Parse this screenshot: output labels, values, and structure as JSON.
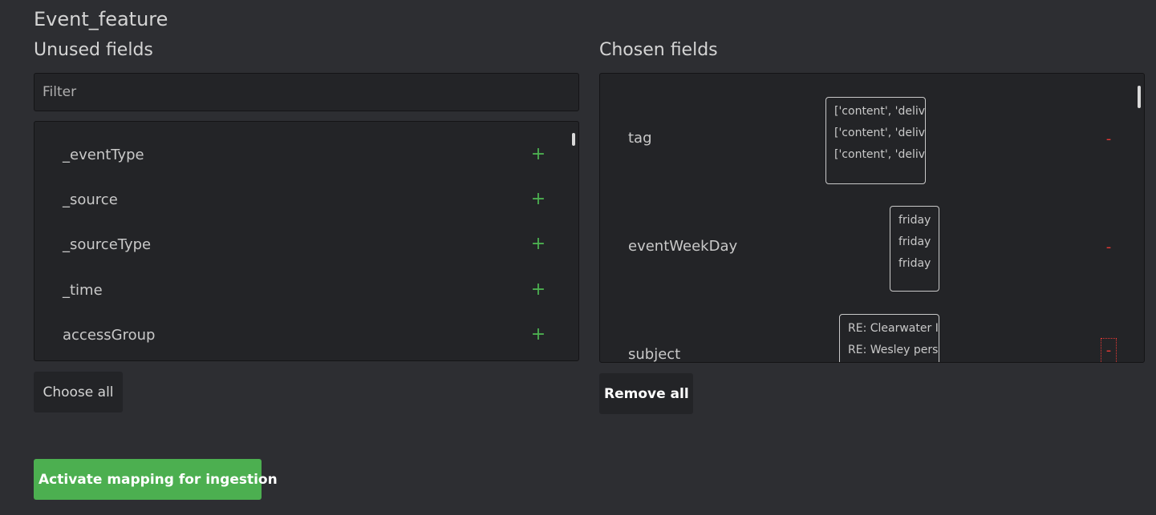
{
  "page": {
    "title": "Event_feature"
  },
  "unused": {
    "title": "Unused fields",
    "filter_placeholder": "Filter",
    "items": [
      {
        "label": "_eventType",
        "action": "+"
      },
      {
        "label": "_source",
        "action": "+"
      },
      {
        "label": "_sourceType",
        "action": "+"
      },
      {
        "label": "_time",
        "action": "+"
      },
      {
        "label": "accessGroup",
        "action": "+"
      }
    ],
    "choose_all_label": "Choose all"
  },
  "chosen": {
    "title": "Chosen fields",
    "items": [
      {
        "label": "tag",
        "samples": [
          "['content', 'delive",
          "['content', 'delive",
          "['content', 'delive"
        ],
        "action": "-"
      },
      {
        "label": "eventWeekDay",
        "samples": [
          "friday",
          "friday",
          "friday"
        ],
        "action": "-"
      },
      {
        "label": "subject",
        "samples": [
          "RE: Clearwater II",
          "RE: Wesley perso"
        ],
        "action": "-"
      }
    ],
    "remove_all_label": "Remove all"
  },
  "actions": {
    "activate_label": "Activate mapping for ingestion"
  },
  "colors": {
    "background": "#2d2e32",
    "panel": "#232427",
    "add": "#4caf50",
    "remove": "#e53935",
    "primary": "#4caf50"
  }
}
